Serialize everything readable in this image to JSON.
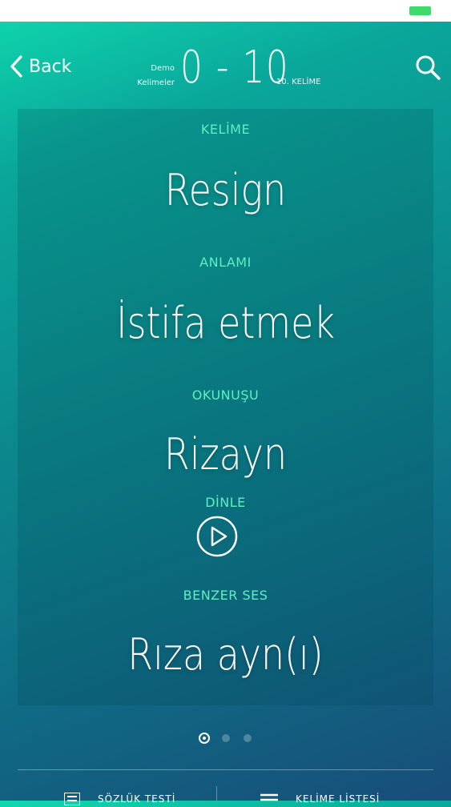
{
  "colors": {
    "accent": "#5ef0c0",
    "battery": "#3ddc6a",
    "text": "#ffffff"
  },
  "header": {
    "back_label": "Back",
    "demo_line1": "Demo",
    "demo_line2": "Kelimeler",
    "range": "0 - 10",
    "word_index": "10. KELİME",
    "search_icon": "search-icon"
  },
  "card": {
    "word_label": "KELİME",
    "word": "Resign",
    "meaning_label": "ANLAMI",
    "meaning": "İstifa etmek",
    "pronunciation_label": "OKUNUŞU",
    "pronunciation": "Rizayn",
    "listen_label": "DİNLE",
    "similar_label": "BENZER SES",
    "similar": "Rıza ayn(ı)"
  },
  "pager": {
    "count": 3,
    "active": 0
  },
  "bottom_tabs": [
    {
      "label": "SÖZLÜK TESTİ",
      "icon": "list-icon"
    },
    {
      "label": "KELİME LİSTESİ",
      "icon": "menu-icon"
    }
  ]
}
